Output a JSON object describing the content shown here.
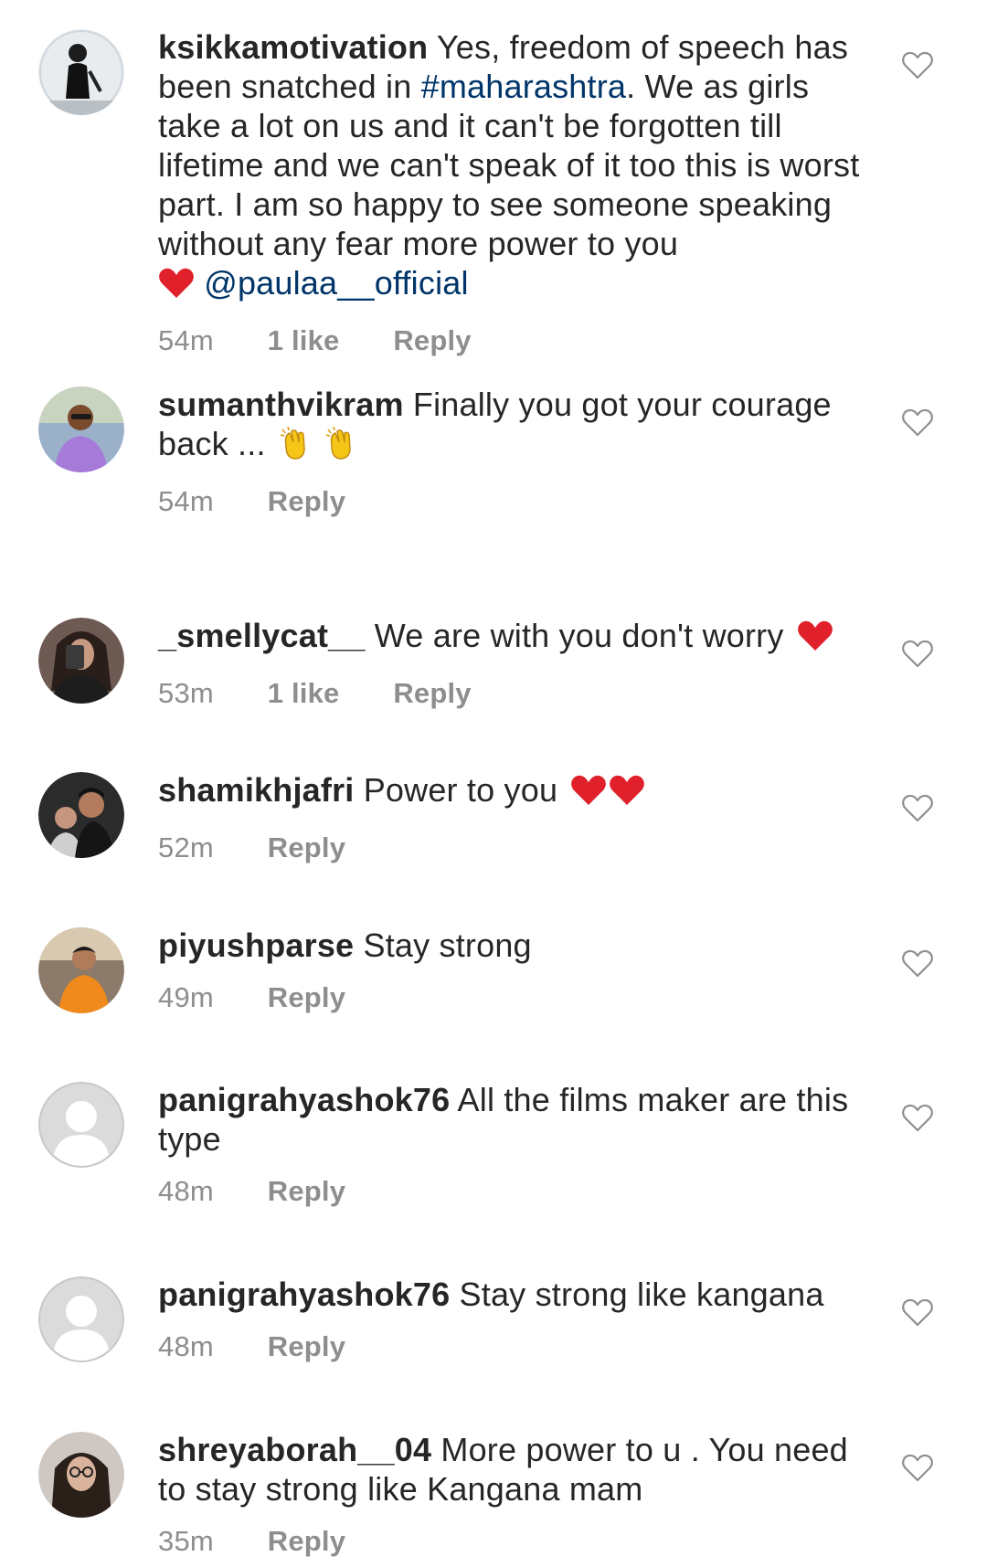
{
  "comments": [
    {
      "username": "ksikkamotivation",
      "text_before": "Yes, freedom of speech has been snatched in ",
      "hashtag": "#maharashtra",
      "text_after": ". We as girls take a lot on us and it can't be forgotten till lifetime and we can't speak of it too this is worst part. I am so happy to see someone speaking without any fear more power to you",
      "mention": "@paulaa__official",
      "time": "54m",
      "likes": "1 like",
      "reply": "Reply",
      "avatar": "photo-woman-standing"
    },
    {
      "username": "sumanthvikram",
      "text": "Finally you got your courage back ...",
      "emojis": [
        "clapping-hands",
        "clapping-hands"
      ],
      "time": "54m",
      "reply": "Reply",
      "avatar": "photo-man-purple-shirt"
    },
    {
      "username": "_smellycat__",
      "text": "We are with you don't worry",
      "emojis": [
        "red-heart"
      ],
      "time": "53m",
      "likes": "1 like",
      "reply": "Reply",
      "avatar": "photo-selfie-dark"
    },
    {
      "username": "shamikhjafri",
      "text": "Power to you",
      "emojis": [
        "red-heart",
        "red-heart"
      ],
      "time": "52m",
      "reply": "Reply",
      "avatar": "photo-couple"
    },
    {
      "username": "piyushparse",
      "text": "Stay strong",
      "time": "49m",
      "reply": "Reply",
      "avatar": "photo-man-orange-shirt"
    },
    {
      "username": "panigrahyashok76",
      "text": "All the films maker are this type",
      "time": "48m",
      "reply": "Reply",
      "avatar": "default-avatar"
    },
    {
      "username": "panigrahyashok76",
      "text": "Stay strong like kangana",
      "time": "48m",
      "reply": "Reply",
      "avatar": "default-avatar"
    },
    {
      "username": "shreyaborah__04",
      "text": "More power to u . You need to stay strong like Kangana mam",
      "time": "35m",
      "reply": "Reply",
      "avatar": "photo-woman-glasses"
    }
  ],
  "colors": {
    "text": "#262626",
    "link": "#003569",
    "meta": "#8e8e8e",
    "heart_emoji": "#e0202b",
    "clap_emoji": "#f5c518"
  },
  "icons": {
    "like": "heart-outline-icon"
  }
}
